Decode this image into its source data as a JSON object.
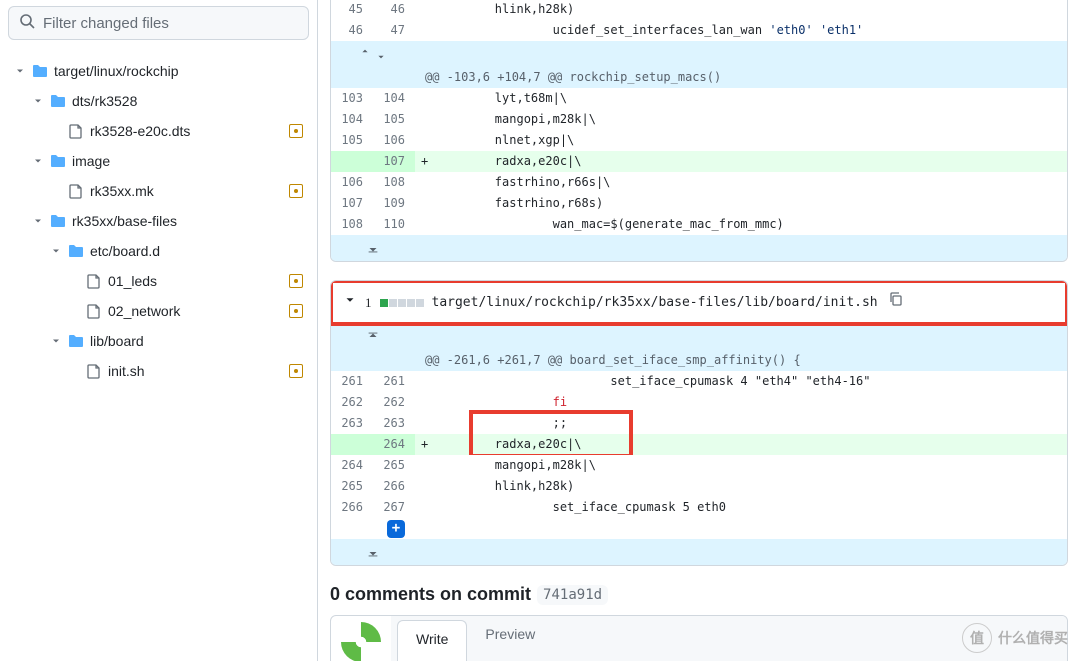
{
  "sidebar": {
    "filter_placeholder": "Filter changed files",
    "tree": [
      {
        "type": "dir",
        "level": 0,
        "label": "target/linux/rockchip",
        "id": "dir-target-linux-rockchip"
      },
      {
        "type": "dir",
        "level": 1,
        "label": "dts/rk3528",
        "id": "dir-dts-rk3528"
      },
      {
        "type": "file",
        "level": 2,
        "label": "rk3528-e20c.dts",
        "id": "file-rk3528-e20c-dts",
        "mod": true
      },
      {
        "type": "dir",
        "level": 1,
        "label": "image",
        "id": "dir-image"
      },
      {
        "type": "file",
        "level": 2,
        "label": "rk35xx.mk",
        "id": "file-rk35xx-mk",
        "mod": true
      },
      {
        "type": "dir",
        "level": 1,
        "label": "rk35xx/base-files",
        "id": "dir-rk35xx-base-files"
      },
      {
        "type": "dir",
        "level": 2,
        "label": "etc/board.d",
        "id": "dir-etc-board-d"
      },
      {
        "type": "file",
        "level": 3,
        "label": "01_leds",
        "id": "file-01-leds",
        "mod": true
      },
      {
        "type": "file",
        "level": 3,
        "label": "02_network",
        "id": "file-02-network",
        "mod": true
      },
      {
        "type": "dir",
        "level": 2,
        "label": "lib/board",
        "id": "dir-lib-board"
      },
      {
        "type": "file",
        "level": 3,
        "label": "init.sh",
        "id": "file-init-sh",
        "mod": true
      }
    ]
  },
  "diff1": {
    "rows": [
      {
        "kind": "context",
        "lnl": "45",
        "lnr": "46",
        "text": "\thlink,h28k)"
      },
      {
        "kind": "context",
        "lnl": "46",
        "lnr": "47",
        "text": "\t\tucidef_set_interfaces_lan_wan 'eth0' 'eth1'",
        "string": true
      },
      {
        "kind": "expand-both"
      },
      {
        "kind": "hunk",
        "text": "@@ -103,6 +104,7 @@ rockchip_setup_macs()"
      },
      {
        "kind": "context",
        "lnl": "103",
        "lnr": "104",
        "text": "\tlyt,t68m|\\"
      },
      {
        "kind": "context",
        "lnl": "104",
        "lnr": "105",
        "text": "\tmangopi,m28k|\\"
      },
      {
        "kind": "context",
        "lnl": "105",
        "lnr": "106",
        "text": "\tnlnet,xgp|\\"
      },
      {
        "kind": "add",
        "lnl": "",
        "lnr": "107",
        "text": "\tradxa,e20c|\\"
      },
      {
        "kind": "context",
        "lnl": "106",
        "lnr": "108",
        "text": "\tfastrhino,r66s|\\"
      },
      {
        "kind": "context",
        "lnl": "107",
        "lnr": "109",
        "text": "\tfastrhino,r68s)"
      },
      {
        "kind": "context",
        "lnl": "108",
        "lnr": "110",
        "text": "\t\twan_mac=$(generate_mac_from_mmc)"
      },
      {
        "kind": "expand-down"
      }
    ]
  },
  "file2": {
    "additions": "1",
    "path": "target/linux/rockchip/rk35xx/base-files/lib/board/init.sh"
  },
  "diff2": {
    "hunk_text": "@@ -261,6 +261,7 @@ board_set_iface_smp_affinity() {",
    "rows": [
      {
        "kind": "expand-up"
      },
      {
        "kind": "hunk"
      },
      {
        "kind": "context",
        "lnl": "261",
        "lnr": "261",
        "text": "\t\t\tset_iface_cpumask 4 \"eth4\" \"eth4-16\""
      },
      {
        "kind": "context",
        "lnl": "262",
        "lnr": "262",
        "text": "\t\tfi",
        "keyword": true
      },
      {
        "kind": "context",
        "lnl": "263",
        "lnr": "263",
        "text": "\t\t;;"
      },
      {
        "kind": "add",
        "lnl": "",
        "lnr": "264",
        "text": "\tradxa,e20c|\\",
        "highlight": true
      },
      {
        "kind": "context",
        "lnl": "264",
        "lnr": "265",
        "text": "\tmangopi,m28k|\\"
      },
      {
        "kind": "context",
        "lnl": "265",
        "lnr": "266",
        "text": "\thlink,h28k)"
      },
      {
        "kind": "context",
        "lnl": "266",
        "lnr": "267",
        "text": "\t\tset_iface_cpumask 5 eth0",
        "plusbtn": true
      },
      {
        "kind": "expand-down"
      }
    ]
  },
  "comments": {
    "heading_prefix": "0 comments on commit",
    "sha": "741a91d",
    "tab_write": "Write",
    "tab_preview": "Preview"
  },
  "watermark": "什么值得买"
}
